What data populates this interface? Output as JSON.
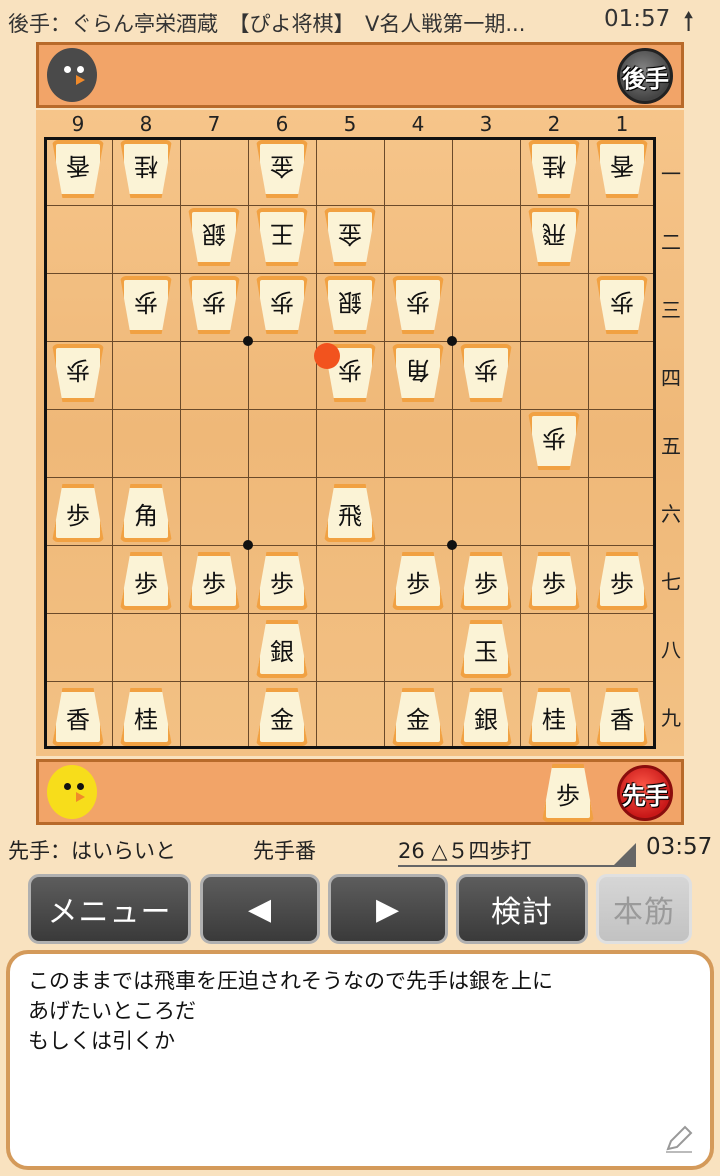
{
  "header": {
    "title": "後手：ぐらん亭栄酒蔵　【ぴよ将棋】　V名人戦第一期...",
    "gote_time": "01:57",
    "back_icon": "up-arrow-icon"
  },
  "gote_stand": {
    "avatar": "crow-avatar",
    "seal": "後手",
    "pieces": []
  },
  "sente_stand": {
    "avatar": "chick-avatar",
    "seal": "先手",
    "pieces": [
      "歩"
    ]
  },
  "board": {
    "col_labels": [
      "9",
      "8",
      "7",
      "6",
      "5",
      "4",
      "3",
      "2",
      "1"
    ],
    "row_labels": [
      "一",
      "二",
      "三",
      "四",
      "五",
      "六",
      "七",
      "八",
      "九"
    ],
    "last_move": "5四",
    "pieces": [
      {
        "file": 9,
        "rank": 1,
        "kind": "香",
        "side": "gote"
      },
      {
        "file": 8,
        "rank": 1,
        "kind": "桂",
        "side": "gote"
      },
      {
        "file": 6,
        "rank": 1,
        "kind": "金",
        "side": "gote"
      },
      {
        "file": 2,
        "rank": 1,
        "kind": "桂",
        "side": "gote"
      },
      {
        "file": 1,
        "rank": 1,
        "kind": "香",
        "side": "gote"
      },
      {
        "file": 7,
        "rank": 2,
        "kind": "銀",
        "side": "gote"
      },
      {
        "file": 6,
        "rank": 2,
        "kind": "王",
        "side": "gote"
      },
      {
        "file": 5,
        "rank": 2,
        "kind": "金",
        "side": "gote"
      },
      {
        "file": 2,
        "rank": 2,
        "kind": "飛",
        "side": "gote"
      },
      {
        "file": 8,
        "rank": 3,
        "kind": "歩",
        "side": "gote"
      },
      {
        "file": 7,
        "rank": 3,
        "kind": "歩",
        "side": "gote"
      },
      {
        "file": 6,
        "rank": 3,
        "kind": "歩",
        "side": "gote"
      },
      {
        "file": 5,
        "rank": 3,
        "kind": "銀",
        "side": "gote"
      },
      {
        "file": 4,
        "rank": 3,
        "kind": "歩",
        "side": "gote"
      },
      {
        "file": 1,
        "rank": 3,
        "kind": "歩",
        "side": "gote"
      },
      {
        "file": 9,
        "rank": 4,
        "kind": "歩",
        "side": "gote"
      },
      {
        "file": 5,
        "rank": 4,
        "kind": "歩",
        "side": "gote"
      },
      {
        "file": 4,
        "rank": 4,
        "kind": "角",
        "side": "gote"
      },
      {
        "file": 3,
        "rank": 4,
        "kind": "歩",
        "side": "gote"
      },
      {
        "file": 2,
        "rank": 5,
        "kind": "歩",
        "side": "gote"
      },
      {
        "file": 9,
        "rank": 6,
        "kind": "歩",
        "side": "sente"
      },
      {
        "file": 8,
        "rank": 6,
        "kind": "角",
        "side": "sente"
      },
      {
        "file": 5,
        "rank": 6,
        "kind": "飛",
        "side": "sente"
      },
      {
        "file": 8,
        "rank": 7,
        "kind": "歩",
        "side": "sente"
      },
      {
        "file": 7,
        "rank": 7,
        "kind": "歩",
        "side": "sente"
      },
      {
        "file": 6,
        "rank": 7,
        "kind": "歩",
        "side": "sente"
      },
      {
        "file": 4,
        "rank": 7,
        "kind": "歩",
        "side": "sente"
      },
      {
        "file": 3,
        "rank": 7,
        "kind": "歩",
        "side": "sente"
      },
      {
        "file": 2,
        "rank": 7,
        "kind": "歩",
        "side": "sente"
      },
      {
        "file": 1,
        "rank": 7,
        "kind": "歩",
        "side": "sente"
      },
      {
        "file": 6,
        "rank": 8,
        "kind": "銀",
        "side": "sente"
      },
      {
        "file": 3,
        "rank": 8,
        "kind": "玉",
        "side": "sente"
      },
      {
        "file": 9,
        "rank": 9,
        "kind": "香",
        "side": "sente"
      },
      {
        "file": 8,
        "rank": 9,
        "kind": "桂",
        "side": "sente"
      },
      {
        "file": 6,
        "rank": 9,
        "kind": "金",
        "side": "sente"
      },
      {
        "file": 4,
        "rank": 9,
        "kind": "金",
        "side": "sente"
      },
      {
        "file": 3,
        "rank": 9,
        "kind": "銀",
        "side": "sente"
      },
      {
        "file": 2,
        "rank": 9,
        "kind": "桂",
        "side": "sente"
      },
      {
        "file": 1,
        "rank": 9,
        "kind": "香",
        "side": "sente"
      }
    ]
  },
  "status": {
    "sente_player": "先手：はいらいと",
    "turn": "先手番",
    "move": "26 △５四歩打",
    "sente_time": "03:57"
  },
  "buttons": {
    "menu": "メニュー",
    "prev": "◀",
    "next": "▶",
    "analyze": "検討",
    "mainline": "本筋"
  },
  "comment": {
    "lines": [
      "このままでは飛車を圧迫されそうなので先手は銀を上に",
      "あげたいところだ",
      "もしくは引くか"
    ],
    "edit_icon": "pencil-icon"
  }
}
